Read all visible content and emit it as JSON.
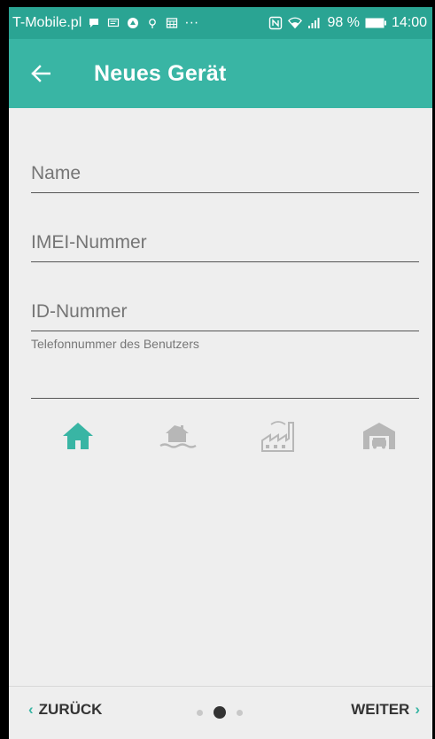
{
  "statusbar": {
    "carrier": "T-Mobile.pl",
    "notification_icons": [
      "chat-bubble-icon",
      "message-icon",
      "app-icon",
      "location-icon",
      "calendar-icon"
    ],
    "more": "···",
    "right_icons": [
      "nfc-icon",
      "wifi-icon",
      "signal-icon"
    ],
    "battery": "98 %",
    "time": "14:00"
  },
  "appbar": {
    "title": "Neues Gerät",
    "back_icon": "arrow-left-icon"
  },
  "form": {
    "name_placeholder": "Name",
    "imei_placeholder": "IMEI-Nummer",
    "id_placeholder": "ID-Nummer",
    "phone_helper": "Telefonnummer des Benutzers",
    "phone_value": ""
  },
  "device_types": [
    {
      "name": "house-icon",
      "selected": true
    },
    {
      "name": "house-water-icon",
      "selected": false
    },
    {
      "name": "factory-icon",
      "selected": false
    },
    {
      "name": "garage-icon",
      "selected": false
    }
  ],
  "bottom": {
    "back_label": "ZURÜCK",
    "next_label": "WEITER",
    "page_count": 3,
    "current_page": 2
  },
  "colors": {
    "accent": "#39b5a4",
    "statusbar": "#2aa493",
    "icon_inactive": "#b7b7b7"
  }
}
